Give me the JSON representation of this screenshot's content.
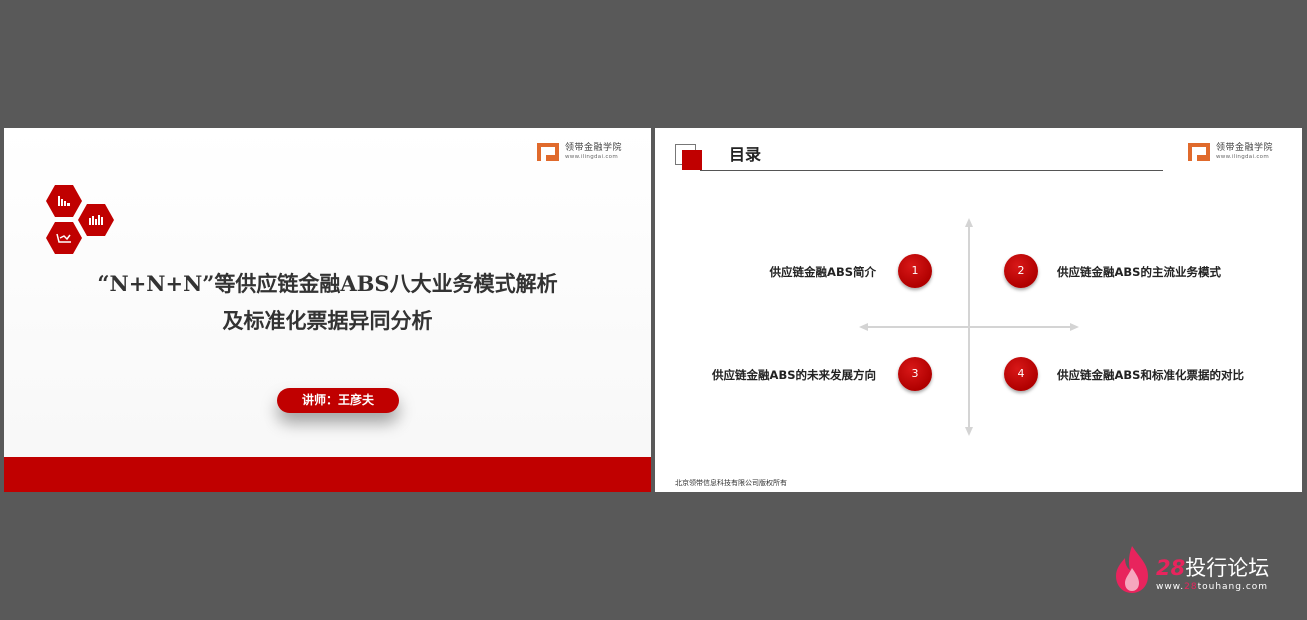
{
  "slide1": {
    "logo": {
      "name": "领带金融学院",
      "url": "www.ilingdai.com"
    },
    "title_line1": "“N+N+N”等供应链金融ABS八大业务模式解析",
    "title_line2": "及标准化票据异同分析",
    "speaker": "讲师：王彦夫"
  },
  "slide2": {
    "logo": {
      "name": "领带金融学院",
      "url": "www.ilingdai.com"
    },
    "heading": "目录",
    "items": [
      {
        "num": "1",
        "label": "供应链金融ABS简介"
      },
      {
        "num": "2",
        "label": "供应链金融ABS的主流业务模式"
      },
      {
        "num": "3",
        "label": "供应链金融ABS的未来发展方向"
      },
      {
        "num": "4",
        "label": "供应链金融ABS和标准化票据的对比"
      }
    ],
    "footer": "北京领带信息科技有限公司版权所有"
  },
  "watermark": {
    "num": "28",
    "name": "投行论坛",
    "url_prefix": "www.",
    "url_num": "28",
    "url_domain": "touhang.com"
  },
  "colors": {
    "accent": "#c00000",
    "logo": "#e06a2c",
    "background": "#595959",
    "watermark": "#e8245d"
  }
}
